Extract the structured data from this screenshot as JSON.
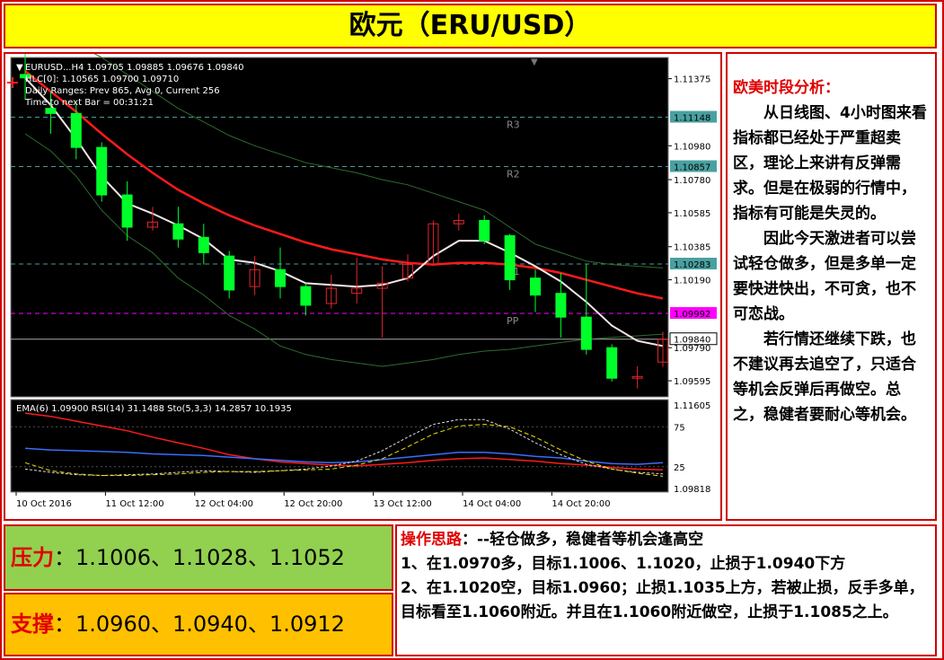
{
  "title": "欧元（ERU/USD）",
  "analysis": {
    "heading": "欧美时段分析：",
    "paragraphs": [
      "从日线图、4小时图来看指标都已经处于严重超卖区，理论上来讲有反弹需求。但是在极弱的行情中，指标有可能是失灵的。",
      "因此今天激进者可以尝试轻仓做多，但是多单一定要快进快出，不可贪，也不可恋战。",
      "若行情还继续下跌，也不建议再去追空了，只适合等机会反弹后再做空。总之，稳健者要耐心等机会。"
    ]
  },
  "pressure": {
    "label": "压力",
    "sep": "：",
    "values": "1.1006、1.1028、1.1052"
  },
  "support": {
    "label": "支撑",
    "sep": "：",
    "values": "1.0960、1.0940、1.0912"
  },
  "operation": {
    "heading": "操作思路",
    "heading_rest": "：--轻仓做多，稳健者等机会逢高空",
    "lines": [
      "1、在1.0970多，目标1.1006、1.1020，止损于1.0940下方",
      "2、在1.1020空，目标1.0960；止损1.1035上方，若被止损，反手多单，目标看至1.1060附近。并且在1.1060附近做空，止损于1.1085之上。"
    ]
  },
  "chart_data": {
    "type": "candlestick",
    "info_lines": [
      "EURUSD...H4  1.09705 1.09885 1.09676 1.09840",
      "HLC[0]: 1.10565 1.09700 1.09710",
      "Daily Ranges:  Prev 865,  Avg 0,  Current 256",
      "Time to next Bar = 00:31:21"
    ],
    "ylim": [
      1.095,
      1.115
    ],
    "y_ticks": [
      "1.11375",
      "1.10980",
      "1.10780",
      "1.10585",
      "1.10385",
      "1.10190",
      "1.09790",
      "1.09595"
    ],
    "x_ticks": [
      "10 Oct 2016",
      "11 Oct 12:00",
      "12 Oct 04:00",
      "12 Oct 20:00",
      "13 Oct 12:00",
      "14 Oct 04:00",
      "14 Oct 20:00"
    ],
    "levels": [
      {
        "name": "R3",
        "value": 1.11148,
        "label": "1.11148",
        "color": "#4a9a9a"
      },
      {
        "name": "R2",
        "value": 1.10857,
        "label": "1.10857",
        "color": "#4a9a9a"
      },
      {
        "name": "R1",
        "value": 1.10283,
        "label": "1.10283",
        "color": "#4a9a9a"
      },
      {
        "name": "PP",
        "value": 1.09992,
        "label": "1.09992",
        "color": "#ff00ff"
      }
    ],
    "current_price": {
      "value": 1.0984,
      "label": "1.09840"
    },
    "candles": [
      [
        1.114,
        1.1138,
        1.1155,
        1.1125
      ],
      [
        1.112,
        1.1117,
        1.113,
        1.1105
      ],
      [
        1.1117,
        1.1097,
        1.1123,
        1.109
      ],
      [
        1.1097,
        1.1069,
        1.11,
        1.1065
      ],
      [
        1.1069,
        1.105,
        1.1077,
        1.1042
      ],
      [
        1.105,
        1.1053,
        1.1062,
        1.1048
      ],
      [
        1.1052,
        1.1043,
        1.1062,
        1.1038
      ],
      [
        1.1044,
        1.1035,
        1.1052,
        1.1028
      ],
      [
        1.1033,
        1.1013,
        1.1036,
        1.1008
      ],
      [
        1.1015,
        1.1025,
        1.1033,
        1.101
      ],
      [
        1.1025,
        1.1015,
        1.1038,
        1.1008
      ],
      [
        1.1015,
        1.1004,
        1.1017,
        1.0998
      ],
      [
        1.1005,
        1.1014,
        1.1022,
        1.1002
      ],
      [
        1.1011,
        1.1014,
        1.1032,
        1.1005
      ],
      [
        1.1014,
        1.1017,
        1.1027,
        1.0985
      ],
      [
        1.102,
        1.1028,
        1.1034,
        1.1018
      ],
      [
        1.1028,
        1.1052,
        1.1054,
        1.1028
      ],
      [
        1.1052,
        1.1054,
        1.1058,
        1.1048
      ],
      [
        1.1054,
        1.1042,
        1.1057,
        1.104
      ],
      [
        1.1045,
        1.1019,
        1.1046,
        1.1013
      ],
      [
        1.102,
        1.101,
        1.1025,
        1.1
      ],
      [
        1.1011,
        1.0997,
        1.1023,
        1.0985
      ],
      [
        1.0997,
        1.0978,
        1.1028,
        1.0975
      ],
      [
        1.0979,
        1.0961,
        1.0981,
        1.0959
      ],
      [
        1.0961,
        1.0962,
        1.0968,
        1.0955
      ],
      [
        1.09705,
        1.0984,
        1.09885,
        1.09676
      ]
    ],
    "ema_red": [
      1.1142,
      1.113,
      1.1118,
      1.1105,
      1.1093,
      1.1082,
      1.1072,
      1.1064,
      1.1057,
      1.1051,
      1.1046,
      1.1041,
      1.1037,
      1.1034,
      1.1031,
      1.1029,
      1.1028,
      1.1029,
      1.1029,
      1.1028,
      1.1026,
      1.1023,
      1.1019,
      1.1015,
      1.1011,
      1.1008
    ],
    "ema_white": [
      1.1138,
      1.1122,
      1.1102,
      1.108,
      1.1064,
      1.1058,
      1.1051,
      1.1043,
      1.1031,
      1.1029,
      1.1024,
      1.1017,
      1.1016,
      1.1015,
      1.1016,
      1.102,
      1.1033,
      1.1042,
      1.1042,
      1.1035,
      1.1027,
      1.1018,
      1.1006,
      1.0992,
      1.0983,
      1.098
    ],
    "band_upper": [
      1.1166,
      1.1162,
      1.1158,
      1.115,
      1.114,
      1.113,
      1.112,
      1.1112,
      1.1104,
      1.1098,
      1.1093,
      1.1088,
      1.1085,
      1.1082,
      1.1078,
      1.1075,
      1.107,
      1.1065,
      1.106,
      1.105,
      1.104,
      1.1035,
      1.103,
      1.1028,
      1.1027,
      1.1026
    ],
    "band_lower": [
      1.1105,
      1.1095,
      1.108,
      1.106,
      1.1045,
      1.1035,
      1.102,
      1.101,
      1.0998,
      1.099,
      1.098,
      1.0975,
      1.0972,
      1.097,
      1.0968,
      1.097,
      1.0972,
      1.0975,
      1.0977,
      1.0978,
      1.098,
      1.0982,
      1.0984,
      1.0985,
      1.0986,
      1.0987
    ],
    "sub_info": "EMA(6) 1.09900  RSI(14) 31.1488  Sto(5,3,3) 14.2857 10.1935",
    "sub_ticks": [
      "1.11605",
      "75",
      "25",
      "1.09818"
    ],
    "sub_lines": {
      "red": [
        92,
        88,
        82,
        76,
        70,
        62,
        55,
        48,
        40,
        35,
        31,
        29,
        27,
        26,
        28,
        30,
        33,
        35,
        36,
        34,
        32,
        29,
        27,
        24,
        22,
        21
      ],
      "blue": [
        48,
        46,
        45,
        44,
        43,
        41,
        40,
        39,
        37,
        35,
        33,
        31,
        30,
        31,
        34,
        37,
        40,
        43,
        43,
        41,
        38,
        36,
        32,
        29,
        28,
        30
      ],
      "white_dash": [
        22,
        18,
        15,
        14,
        15,
        16,
        18,
        20,
        19,
        18,
        20,
        22,
        26,
        32,
        45,
        62,
        78,
        84,
        84,
        72,
        55,
        40,
        28,
        22,
        18,
        16
      ],
      "yellow_dash": [
        30,
        20,
        16,
        14,
        14,
        15,
        16,
        18,
        19,
        19,
        20,
        21,
        22,
        27,
        35,
        50,
        66,
        76,
        78,
        75,
        62,
        46,
        32,
        22,
        17,
        13
      ]
    }
  }
}
